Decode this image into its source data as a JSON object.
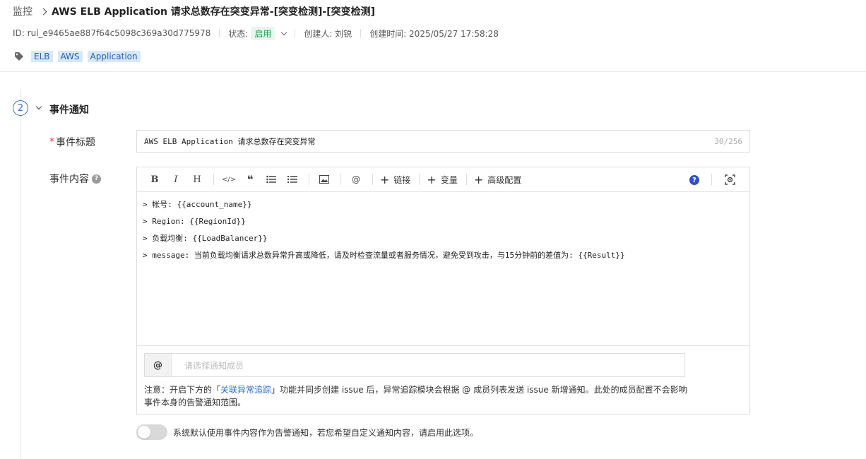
{
  "breadcrumb": {
    "root": "监控",
    "title": "AWS ELB Application 请求总数存在突变异常-[突变检测]-[突变检测]"
  },
  "meta": {
    "id": "ID: rul_e9465ae887f64c5098c369a30d775978",
    "status_label": "状态:",
    "status_value": "启用",
    "creator": "创建人: 刘锐",
    "created_time": "创建时间: 2025/05/27 17:58:28"
  },
  "tags": [
    "ELB",
    "AWS",
    "Application"
  ],
  "section": {
    "step": "2",
    "title": "事件通知"
  },
  "event_title": {
    "required_mark": "*",
    "label": "事件标题",
    "value": "AWS ELB Application 请求总数存在突变异常",
    "count": "30/256"
  },
  "event_content": {
    "label": "事件内容",
    "toolbar": {
      "bold": "B",
      "italic": "I",
      "heading": "H",
      "code": "</>",
      "quote": "❝",
      "mention": "@",
      "link": "链接",
      "variable": "变量",
      "advanced": "高级配置",
      "plus": "+",
      "help": "?"
    },
    "lines": [
      "> 帐号: {{account_name}}",
      "> Region: {{RegionId}}",
      "> 负载均衡: {{LoadBalancer}}",
      "> message: 当前负载均衡请求总数异常升高或降低，请及时检查流量或者服务情况，避免受到攻击，与15分钟前的差值为: {{Result}}"
    ]
  },
  "members": {
    "at": "@",
    "placeholder": "请选择通知成员"
  },
  "note": {
    "prefix": "注意：开启下方的「",
    "link": "关联异常追踪",
    "suffix": "」功能并同步创建 issue 后，异常追踪模块会根据 @ 成员列表发送 issue 新增通知。此处的成员配置不会影响事件本身的告警通知范围。"
  },
  "toggle": {
    "enabled": false,
    "label": "系统默认使用事件内容作为告警通知，若您希望自定义通知内容，请启用此选项。"
  }
}
